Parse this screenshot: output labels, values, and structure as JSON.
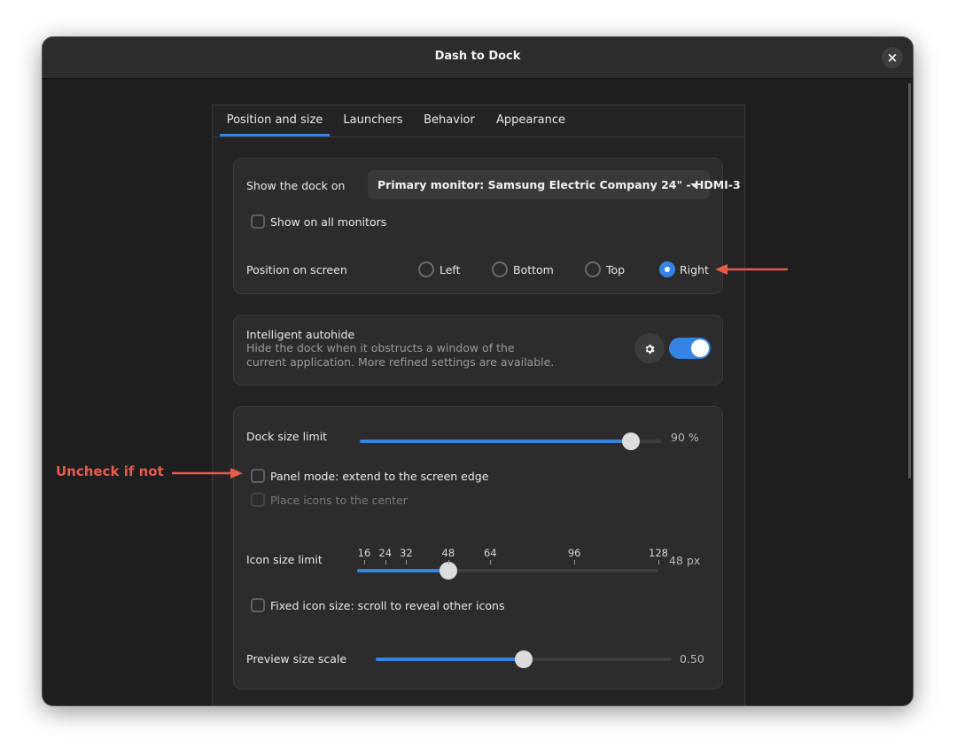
{
  "window": {
    "title": "Dash to Dock"
  },
  "tabs": [
    {
      "label": "Position and size",
      "active": true
    },
    {
      "label": "Launchers",
      "active": false
    },
    {
      "label": "Behavior",
      "active": false
    },
    {
      "label": "Appearance",
      "active": false
    }
  ],
  "monitor": {
    "label": "Show the dock on",
    "selected": "Primary monitor: Samsung Electric Company 24\" - HDMI-3",
    "show_all_label": "Show on all monitors",
    "show_all_checked": false
  },
  "position": {
    "label": "Position on screen",
    "options": [
      "Left",
      "Bottom",
      "Top",
      "Right"
    ],
    "selected": "Right"
  },
  "autohide": {
    "title": "Intelligent autohide",
    "desc_line1": "Hide the dock when it obstructs a window of the",
    "desc_line2": "current application. More refined settings are available.",
    "enabled": true
  },
  "dock_size": {
    "label": "Dock size limit",
    "value_text": "90 %",
    "value": 0.9
  },
  "panel_mode": {
    "label": "Panel mode: extend to the screen edge",
    "checked": false
  },
  "center_icons": {
    "label": "Place icons to the center",
    "checked": false,
    "disabled": true
  },
  "icon_size": {
    "label": "Icon size limit",
    "marks": [
      "16",
      "24",
      "32",
      "48",
      "64",
      "96",
      "128"
    ],
    "value": 48,
    "value_text": "48 px"
  },
  "fixed_icon": {
    "label": "Fixed icon size: scroll to reveal other icons",
    "checked": false
  },
  "preview_scale": {
    "label": "Preview size scale",
    "value_text": "0.50",
    "value": 0.5
  },
  "annotations": {
    "uncheck_text": "Uncheck if not",
    "color": "#e85a4a"
  },
  "colors": {
    "accent": "#3584e4",
    "window_bg": "#1e1e1e",
    "card_bg": "#2c2c2c"
  }
}
